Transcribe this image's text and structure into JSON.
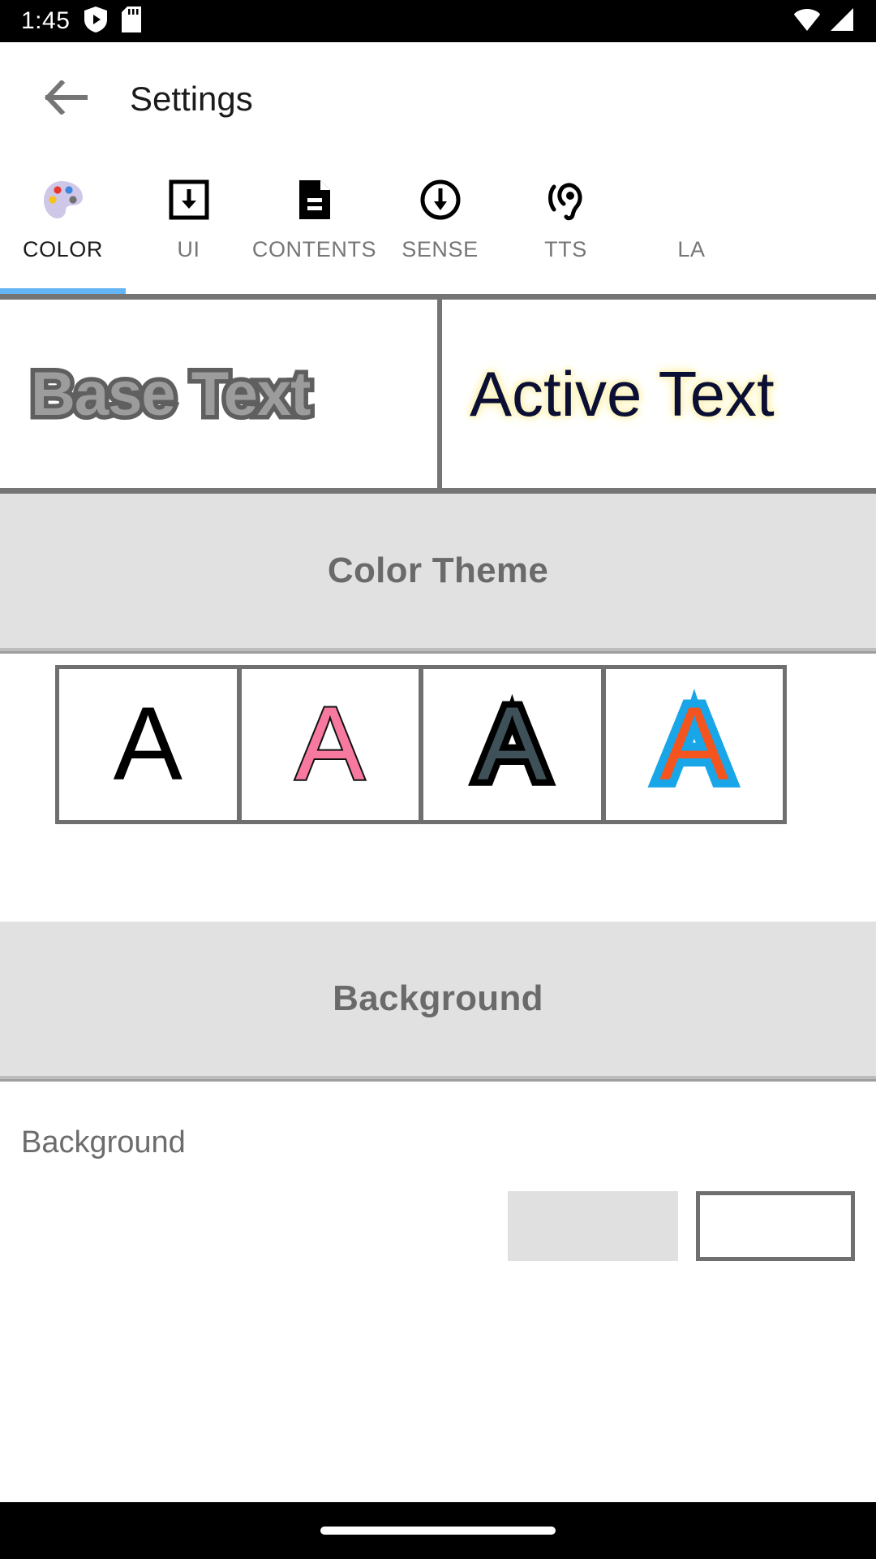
{
  "status_bar": {
    "clock": "1:45",
    "left_icons": [
      "shield-play-icon",
      "sd-card-icon"
    ],
    "right_icons": [
      "wifi-icon",
      "signal-icon"
    ],
    "background_color": "#000000",
    "foreground_color": "#ffffff"
  },
  "toolbar": {
    "back_icon": "back-arrow-icon",
    "title": "Settings",
    "title_color": "#1b1b1b"
  },
  "tabs": {
    "selected_index": 0,
    "indicator_color": "#64b5f6",
    "items": [
      {
        "label": "COLOR",
        "icon": "palette-icon",
        "selected": true
      },
      {
        "label": "UI",
        "icon": "download-box-icon",
        "selected": false
      },
      {
        "label": "CONTENTS",
        "icon": "document-icon",
        "selected": false
      },
      {
        "label": "SENSE",
        "icon": "circle-down-arrow-icon",
        "selected": false
      },
      {
        "label": "TTS",
        "icon": "ear-hearing-icon",
        "selected": false
      },
      {
        "label": "LA",
        "icon": "cut-off-icon",
        "selected": false
      }
    ]
  },
  "preview": {
    "base": {
      "text": "Base Text",
      "fill_color": "#9c9c9c",
      "outline_color": "#5f5f5f"
    },
    "active": {
      "text": "Active Text",
      "fill_color": "#0b0f33",
      "glow_color": "#fdf6c8"
    },
    "border_color": "#757575"
  },
  "sections": [
    {
      "id": "color-theme",
      "title": "Color Theme",
      "title_color": "#6a6a6a",
      "band_color": "#e1e1e1"
    },
    {
      "id": "background",
      "title": "Background",
      "title_color": "#6a6a6a",
      "band_color": "#e1e1e1"
    }
  ],
  "color_theme": {
    "title": "Color Theme",
    "swatches": [
      {
        "glyph": "A",
        "name": "theme-black",
        "fill": "#000000",
        "outline": "none"
      },
      {
        "glyph": "A",
        "name": "theme-pink",
        "fill": "#f8799f",
        "outline": "#111111"
      },
      {
        "glyph": "A",
        "name": "theme-slate",
        "fill": "#3e5058",
        "outline": "#000000"
      },
      {
        "glyph": "A",
        "name": "theme-blue-orange",
        "fill": "#f4541d",
        "outline": "#18a6e8"
      }
    ],
    "frame_color": "#6f6f6f"
  },
  "background_section": {
    "title": "Background",
    "row_label": "Background",
    "row_label_color": "#6c6c6c",
    "chip_color": "#e0e0e0",
    "box_border_color": "#6f6f6f"
  },
  "nav_bar": {
    "pill": "home-gesture-pill",
    "background_color": "#000000"
  }
}
